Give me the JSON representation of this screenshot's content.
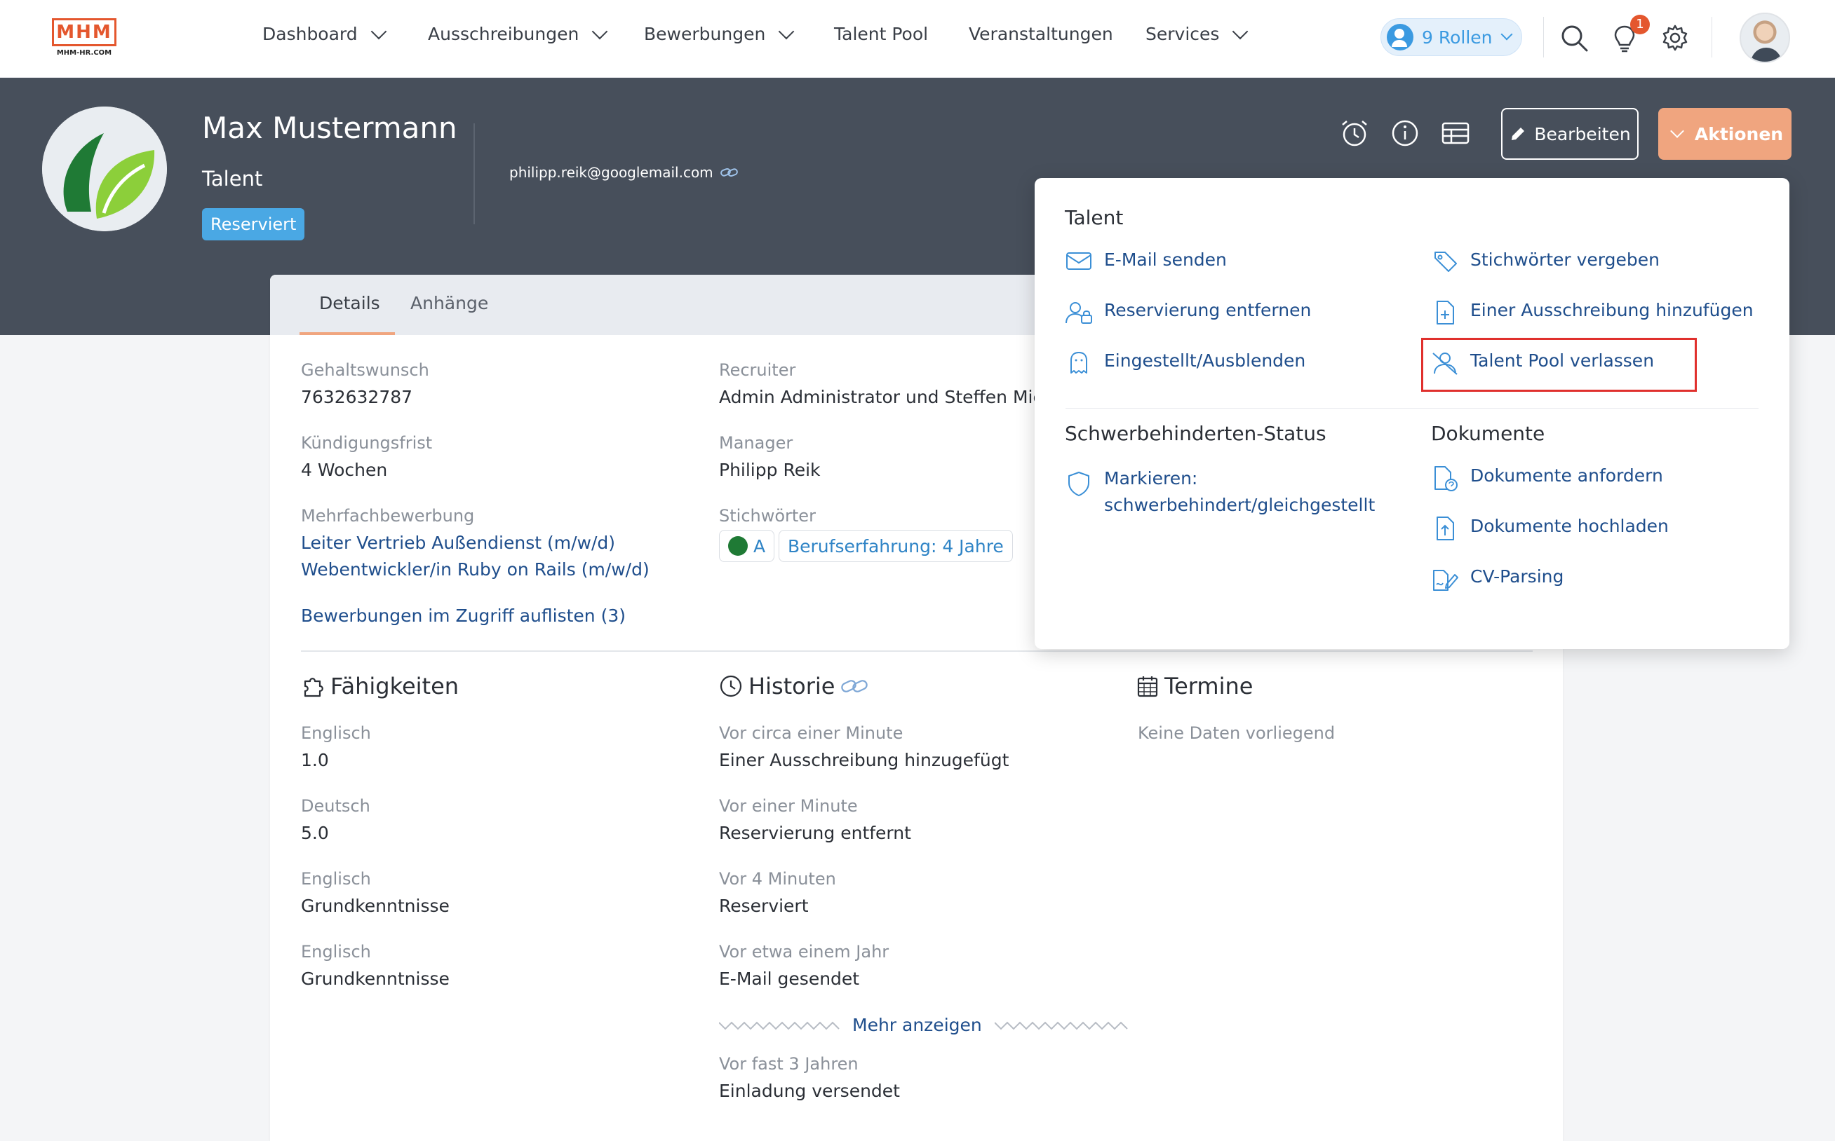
{
  "brand": {
    "logo_text": "MHM",
    "logo_sub": "MHM-HR.COM"
  },
  "nav": {
    "items": [
      {
        "label": "Dashboard",
        "has_menu": true
      },
      {
        "label": "Ausschreibungen",
        "has_menu": true
      },
      {
        "label": "Bewerbungen",
        "has_menu": true
      },
      {
        "label": "Talent Pool",
        "has_menu": false
      },
      {
        "label": "Veranstaltungen",
        "has_menu": false
      },
      {
        "label": "Services",
        "has_menu": true
      }
    ],
    "roles_label": "9 Rollen",
    "notification_count": "1"
  },
  "profile": {
    "name": "Max Mustermann",
    "role": "Talent",
    "status": "Reserviert",
    "email": "philipp.reik@googlemail.com",
    "edit_label": "Bearbeiten",
    "actions_label": "Aktionen"
  },
  "tabs": [
    {
      "label": "Details",
      "active": true
    },
    {
      "label": "Anhänge",
      "active": false
    }
  ],
  "details": {
    "salary_label": "Gehaltswunsch",
    "salary_value": "7632632787",
    "notice_label": "Kündigungsfrist",
    "notice_value": "4 Wochen",
    "multi_label": "Mehrfachbewerbung",
    "multi_values": [
      "Leiter Vertrieb Außendienst (m/w/d)",
      "Webentwickler/in Ruby on Rails (m/w/d)"
    ],
    "list_link": "Bewerbungen im Zugriff auflisten (3)",
    "recruiter_label": "Recruiter",
    "recruiter_value": "Admin Administrator und Steffen Miche",
    "manager_label": "Manager",
    "manager_value": "Philipp Reik",
    "keywords_label": "Stichwörter",
    "keywords": [
      "A",
      "Berufserfahrung: 4 Jahre"
    ]
  },
  "skills": {
    "title": "Fähigkeiten",
    "items": [
      {
        "name": "Englisch",
        "level": "1.0"
      },
      {
        "name": "Deutsch",
        "level": "5.0"
      },
      {
        "name": "Englisch",
        "level": "Grundkenntnisse"
      },
      {
        "name": "Englisch",
        "level": "Grundkenntnisse"
      }
    ]
  },
  "history": {
    "title": "Historie",
    "items": [
      {
        "time": "Vor circa einer Minute",
        "event": "Einer Ausschreibung hinzugefügt"
      },
      {
        "time": "Vor einer Minute",
        "event": "Reservierung entfernt"
      },
      {
        "time": "Vor 4 Minuten",
        "event": "Reserviert"
      },
      {
        "time": "Vor etwa einem Jahr",
        "event": "E-Mail gesendet"
      }
    ],
    "more_label": "Mehr anzeigen",
    "after_more": {
      "time": "Vor fast 3 Jahren",
      "event": "Einladung versendet"
    }
  },
  "appointments": {
    "title": "Termine",
    "empty": "Keine Daten vorliegend"
  },
  "menu": {
    "talent_heading": "Talent",
    "talent_items": [
      {
        "label": "E-Mail senden",
        "icon": "envelope-icon"
      },
      {
        "label": "Stichwörter vergeben",
        "icon": "tag-icon"
      },
      {
        "label": "Reservierung entfernen",
        "icon": "user-remove-icon"
      },
      {
        "label": "Einer Ausschreibung hinzufügen",
        "icon": "file-add-icon"
      },
      {
        "label": "Eingestellt/Ausblenden",
        "icon": "ghost-icon"
      },
      {
        "label": "Talent Pool verlassen",
        "icon": "user-off-icon"
      }
    ],
    "disability_heading": "Schwerbehinderten-Status",
    "disability_item_line1": "Markieren:",
    "disability_item_line2": "schwerbehindert/gleichgestellt",
    "documents_heading": "Dokumente",
    "documents_items": [
      {
        "label": "Dokumente anfordern",
        "icon": "document-request-icon"
      },
      {
        "label": "Dokumente hochladen",
        "icon": "document-upload-icon"
      },
      {
        "label": "CV-Parsing",
        "icon": "cv-parsing-icon"
      }
    ],
    "highlighted_item": "Talent Pool verlassen"
  },
  "colors": {
    "accent": "#f0a57f",
    "header_band": "#474f5b",
    "link": "#1f4e8c",
    "status_badge": "#4aa8e4",
    "highlight": "#e0302d"
  }
}
